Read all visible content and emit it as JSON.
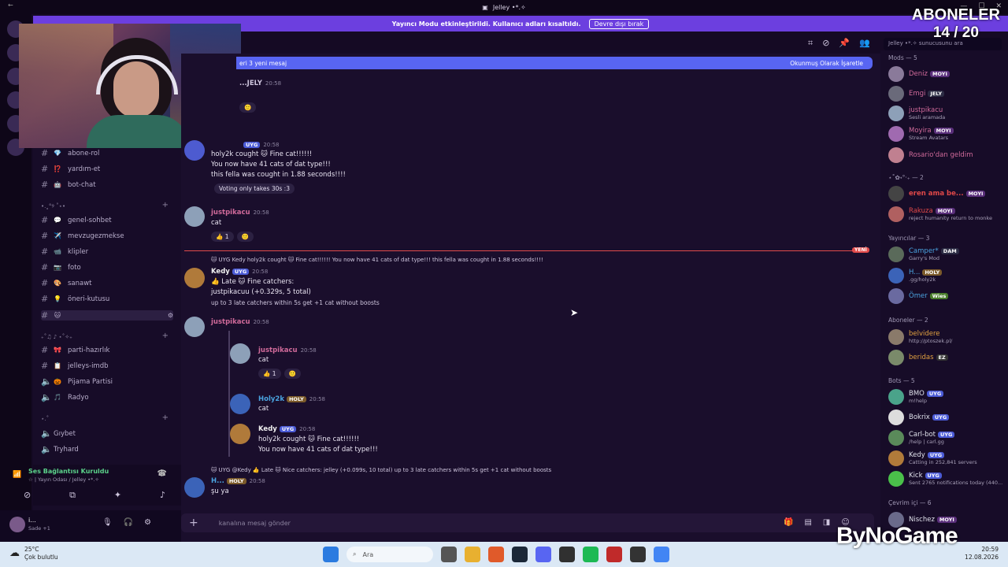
{
  "window": {
    "title": "Jelley •*.✧"
  },
  "notice": {
    "text": "Yayıncı Modu etkinleştirildi. Kullanıcı adları kısaltıldı.",
    "button": "Devre dışı bırak"
  },
  "overlay": {
    "subs_label": "ABONELER",
    "subs_count": "14 / 20",
    "brand": "ByNoGame"
  },
  "new_messages": {
    "left": "eri 3 yeni mesaj",
    "right": "Okunmuş Olarak İşaretle"
  },
  "search": {
    "placeholder": "Jelley •*.✧ sunucusunu ara"
  },
  "sidebar": {
    "channels_top": [
      {
        "emoji": "💎",
        "name": "abone-rol"
      },
      {
        "emoji": "⁉️",
        "name": "yardım-et"
      },
      {
        "emoji": "🤖",
        "name": "bot-chat"
      }
    ],
    "cat1": "•.˳°୨ ˚⋆•",
    "channels_mid": [
      {
        "emoji": "💬",
        "name": "genel-sohbet"
      },
      {
        "emoji": "✈️",
        "name": "mevzugezmekse"
      },
      {
        "emoji": "📹",
        "name": "klipler"
      },
      {
        "emoji": "📷",
        "name": "foto"
      },
      {
        "emoji": "🎨",
        "name": "sanawt"
      },
      {
        "emoji": "💡",
        "name": "öneri-kutusu"
      },
      {
        "emoji": "🐱",
        "name": ""
      }
    ],
    "cat2": "₊˚♫ ♪ ⋆˚✧₊",
    "channels_low": [
      {
        "emoji": "🎀",
        "name": "parti-hazırlık"
      },
      {
        "emoji": "📋",
        "name": "jelleys-imdb"
      },
      {
        "emoji": "🎃",
        "name": "Pijama Partisi"
      },
      {
        "emoji": "🎵",
        "name": "Radyo"
      }
    ],
    "cat3": "⋆.˚",
    "voice_channels": [
      "Gıybet",
      "Tryhard"
    ],
    "voice_status": {
      "title": "Ses Bağlantısı Kuruldu",
      "subtitle": "☆ | Yayın Odası / Jelley •*.✧"
    },
    "user": {
      "name": "i...",
      "status": "Sade +1"
    }
  },
  "messages": [
    {
      "name": "...JELY",
      "time": "20:58"
    },
    {
      "name": "",
      "tag": "UYG",
      "time": "20:58",
      "lines": [
        "holy2k cought 🐱 Fine cat!!!!!!",
        "You now have 41 cats of dat type!!!",
        "this fella was cought in 1.88 seconds!!!!"
      ],
      "extra": "Voting only takes 30s :3"
    },
    {
      "name": "justpikacu",
      "time": "20:58",
      "lines": [
        "cat"
      ],
      "react": [
        "👍 1",
        "🙂"
      ]
    },
    {
      "reply": "🐱 UYG Kedy holy2k cought 🐱 Fine cat!!!!!! You now have 41 cats of dat type!!! this fella was cought in 1.88 seconds!!!!",
      "name": "Kedy",
      "tag": "UYG",
      "time": "20:58",
      "lines": [
        "👍 Late 🐱 Fine catchers:",
        "justpikacuu (+0.329s, 5 total)"
      ],
      "small": "up to 3 late catchers within 5s get +1 cat without boosts"
    },
    {
      "name": "justpikacu",
      "time": "20:58"
    },
    {
      "name": "justpikacu",
      "time": "20:58",
      "lines": [
        "cat"
      ],
      "react": [
        "👍 1",
        "🙂"
      ]
    },
    {
      "name": "Holy2k",
      "tag": "HOLY",
      "time": "20:58",
      "lines": [
        "cat"
      ]
    },
    {
      "name": "Kedy",
      "tag": "UYG",
      "time": "20:58",
      "lines": [
        "holy2k cought 🐱 Fine cat!!!!!!",
        "You now have 41 cats of dat type!!!"
      ]
    },
    {
      "reply": "🐱 UYG @Kedy 👍 Late 🐱 Nice catchers: jelley (+0.099s, 10 total) up to 3 late catchers within 5s get +1 cat without boosts",
      "name": "H...",
      "tag": "HOLY",
      "time": "20:58",
      "lines": [
        "şu ya"
      ]
    }
  ],
  "divider": {
    "label": "YENİ"
  },
  "composer": {
    "placeholder": "kanalına mesaj gönder"
  },
  "members": {
    "groups": [
      {
        "title": "Mods — 5"
      },
      {
        "title": "⋆˚✿˖°‧₊ — 2"
      },
      {
        "title": "Yayıncılar — 3"
      },
      {
        "title": "Aboneler — 2"
      },
      {
        "title": "Bots — 5"
      },
      {
        "title": "Çevrim içi — 6"
      }
    ],
    "list": [
      {
        "name": "Deniz",
        "tag": "MOYI",
        "color": "#d06a9a"
      },
      {
        "name": "Emgi",
        "tag": "JELY",
        "color": "#d06a9a"
      },
      {
        "name": "justpikacu",
        "sub": "Sesli aramada",
        "color": "#d06a9a"
      },
      {
        "name": "Moyira",
        "tag": "MOYI",
        "sub": "Stream Avatars",
        "color": "#d06a9a"
      },
      {
        "name": "Rosario'dan geldim",
        "color": "#d06a9a"
      },
      {
        "name": "eren ama be...",
        "tag": "MOYI",
        "color": "#e04848"
      },
      {
        "name": "Rakuza",
        "tag": "MOYI",
        "sub": "reject humanity return to monke",
        "color": "#e04848"
      },
      {
        "name": "Camper*",
        "tag": "DAM",
        "sub": "Garry's Mod",
        "color": "#4aa3df"
      },
      {
        "name": "H...",
        "tag": "HOLY",
        "sub": ".gg/holy2k",
        "color": "#4aa3df"
      },
      {
        "name": "Ömer",
        "tag": "Wies",
        "color": "#4aa3df"
      },
      {
        "name": "belvidere",
        "sub": "http://ptoszek.pl/",
        "color": "#e0a040"
      },
      {
        "name": "beridas",
        "tag": "EZ",
        "color": "#e0a040"
      },
      {
        "name": "BMO",
        "tag": "UYG",
        "sub": "m!help",
        "color": "#dfe0ea"
      },
      {
        "name": "Bokrix",
        "tag": "UYG",
        "color": "#dfe0ea"
      },
      {
        "name": "Carl-bot",
        "tag": "UYG",
        "sub": "/help | carl.gg",
        "color": "#dfe0ea"
      },
      {
        "name": "Kedy",
        "tag": "UYG",
        "sub": "Catting in 252,841 servers",
        "color": "#dfe0ea"
      },
      {
        "name": "Kick",
        "tag": "UYG",
        "sub": "Sent 2765 notifications today (440...",
        "color": "#dfe0ea"
      },
      {
        "name": "Nischez",
        "tag": "MOYI",
        "color": "#dfe0ea"
      }
    ]
  },
  "taskbar": {
    "weather_temp": "25°C",
    "weather_desc": "Çok bulutlu",
    "search": "Ara",
    "time": "20:59",
    "date": "12.08.2026"
  }
}
